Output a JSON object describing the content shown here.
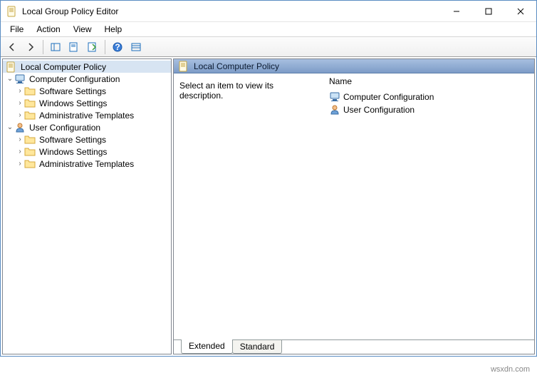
{
  "window": {
    "title": "Local Group Policy Editor"
  },
  "menu": {
    "file": "File",
    "action": "Action",
    "view": "View",
    "help": "Help"
  },
  "tree": {
    "root": "Local Computer Policy",
    "comp": "Computer Configuration",
    "user": "User Configuration",
    "sw": "Software Settings",
    "win": "Windows Settings",
    "adm": "Administrative Templates"
  },
  "detail": {
    "header": "Local Computer Policy",
    "select_hint": "Select an item to view its description.",
    "col_name": "Name",
    "item_comp": "Computer Configuration",
    "item_user": "User Configuration"
  },
  "tabs": {
    "extended": "Extended",
    "standard": "Standard"
  },
  "watermark": "wsxdn.com"
}
